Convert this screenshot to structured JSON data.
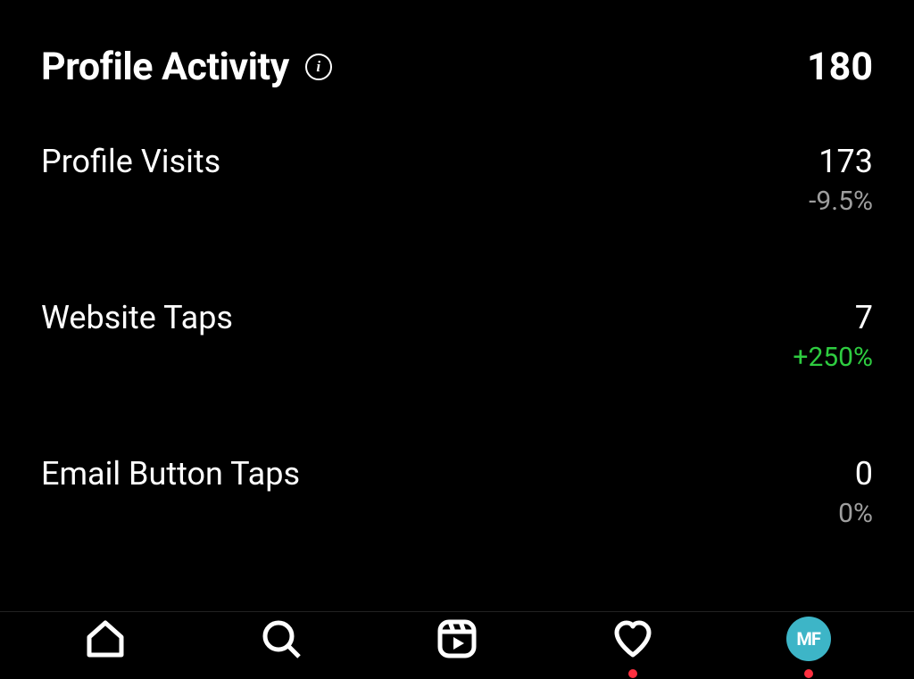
{
  "header": {
    "title": "Profile Activity",
    "info_glyph": "i",
    "total": "180"
  },
  "metrics": [
    {
      "label": "Profile Visits",
      "value": "173",
      "change": "-9.5%",
      "change_class": "change-negative"
    },
    {
      "label": "Website Taps",
      "value": "7",
      "change": "+250%",
      "change_class": "change-positive"
    },
    {
      "label": "Email Button Taps",
      "value": "0",
      "change": "0%",
      "change_class": "change-negative"
    }
  ],
  "footer": {
    "avatar_initials": "MF"
  }
}
